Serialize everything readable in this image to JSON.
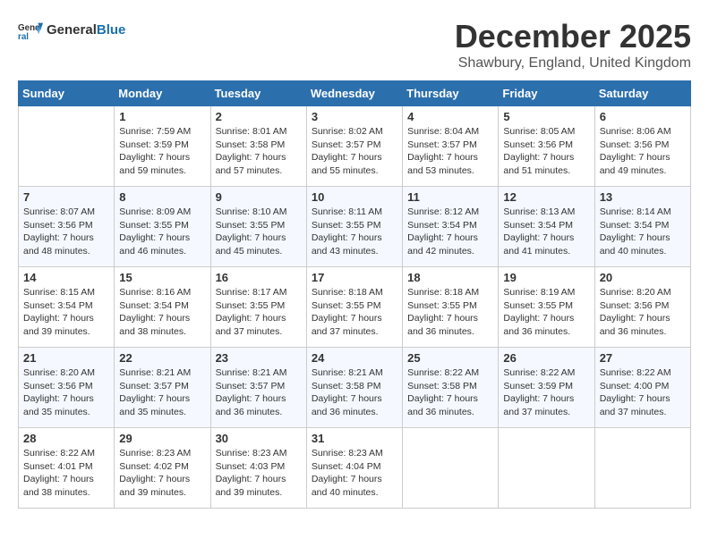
{
  "header": {
    "logo": {
      "general": "General",
      "blue": "Blue"
    },
    "title": "December 2025",
    "location": "Shawbury, England, United Kingdom"
  },
  "weekdays": [
    "Sunday",
    "Monday",
    "Tuesday",
    "Wednesday",
    "Thursday",
    "Friday",
    "Saturday"
  ],
  "weeks": [
    [
      {
        "day": "",
        "info": ""
      },
      {
        "day": "1",
        "info": "Sunrise: 7:59 AM\nSunset: 3:59 PM\nDaylight: 7 hours\nand 59 minutes."
      },
      {
        "day": "2",
        "info": "Sunrise: 8:01 AM\nSunset: 3:58 PM\nDaylight: 7 hours\nand 57 minutes."
      },
      {
        "day": "3",
        "info": "Sunrise: 8:02 AM\nSunset: 3:57 PM\nDaylight: 7 hours\nand 55 minutes."
      },
      {
        "day": "4",
        "info": "Sunrise: 8:04 AM\nSunset: 3:57 PM\nDaylight: 7 hours\nand 53 minutes."
      },
      {
        "day": "5",
        "info": "Sunrise: 8:05 AM\nSunset: 3:56 PM\nDaylight: 7 hours\nand 51 minutes."
      },
      {
        "day": "6",
        "info": "Sunrise: 8:06 AM\nSunset: 3:56 PM\nDaylight: 7 hours\nand 49 minutes."
      }
    ],
    [
      {
        "day": "7",
        "info": "Sunrise: 8:07 AM\nSunset: 3:56 PM\nDaylight: 7 hours\nand 48 minutes."
      },
      {
        "day": "8",
        "info": "Sunrise: 8:09 AM\nSunset: 3:55 PM\nDaylight: 7 hours\nand 46 minutes."
      },
      {
        "day": "9",
        "info": "Sunrise: 8:10 AM\nSunset: 3:55 PM\nDaylight: 7 hours\nand 45 minutes."
      },
      {
        "day": "10",
        "info": "Sunrise: 8:11 AM\nSunset: 3:55 PM\nDaylight: 7 hours\nand 43 minutes."
      },
      {
        "day": "11",
        "info": "Sunrise: 8:12 AM\nSunset: 3:54 PM\nDaylight: 7 hours\nand 42 minutes."
      },
      {
        "day": "12",
        "info": "Sunrise: 8:13 AM\nSunset: 3:54 PM\nDaylight: 7 hours\nand 41 minutes."
      },
      {
        "day": "13",
        "info": "Sunrise: 8:14 AM\nSunset: 3:54 PM\nDaylight: 7 hours\nand 40 minutes."
      }
    ],
    [
      {
        "day": "14",
        "info": "Sunrise: 8:15 AM\nSunset: 3:54 PM\nDaylight: 7 hours\nand 39 minutes."
      },
      {
        "day": "15",
        "info": "Sunrise: 8:16 AM\nSunset: 3:54 PM\nDaylight: 7 hours\nand 38 minutes."
      },
      {
        "day": "16",
        "info": "Sunrise: 8:17 AM\nSunset: 3:55 PM\nDaylight: 7 hours\nand 37 minutes."
      },
      {
        "day": "17",
        "info": "Sunrise: 8:18 AM\nSunset: 3:55 PM\nDaylight: 7 hours\nand 37 minutes."
      },
      {
        "day": "18",
        "info": "Sunrise: 8:18 AM\nSunset: 3:55 PM\nDaylight: 7 hours\nand 36 minutes."
      },
      {
        "day": "19",
        "info": "Sunrise: 8:19 AM\nSunset: 3:55 PM\nDaylight: 7 hours\nand 36 minutes."
      },
      {
        "day": "20",
        "info": "Sunrise: 8:20 AM\nSunset: 3:56 PM\nDaylight: 7 hours\nand 36 minutes."
      }
    ],
    [
      {
        "day": "21",
        "info": "Sunrise: 8:20 AM\nSunset: 3:56 PM\nDaylight: 7 hours\nand 35 minutes."
      },
      {
        "day": "22",
        "info": "Sunrise: 8:21 AM\nSunset: 3:57 PM\nDaylight: 7 hours\nand 35 minutes."
      },
      {
        "day": "23",
        "info": "Sunrise: 8:21 AM\nSunset: 3:57 PM\nDaylight: 7 hours\nand 36 minutes."
      },
      {
        "day": "24",
        "info": "Sunrise: 8:21 AM\nSunset: 3:58 PM\nDaylight: 7 hours\nand 36 minutes."
      },
      {
        "day": "25",
        "info": "Sunrise: 8:22 AM\nSunset: 3:58 PM\nDaylight: 7 hours\nand 36 minutes."
      },
      {
        "day": "26",
        "info": "Sunrise: 8:22 AM\nSunset: 3:59 PM\nDaylight: 7 hours\nand 37 minutes."
      },
      {
        "day": "27",
        "info": "Sunrise: 8:22 AM\nSunset: 4:00 PM\nDaylight: 7 hours\nand 37 minutes."
      }
    ],
    [
      {
        "day": "28",
        "info": "Sunrise: 8:22 AM\nSunset: 4:01 PM\nDaylight: 7 hours\nand 38 minutes."
      },
      {
        "day": "29",
        "info": "Sunrise: 8:23 AM\nSunset: 4:02 PM\nDaylight: 7 hours\nand 39 minutes."
      },
      {
        "day": "30",
        "info": "Sunrise: 8:23 AM\nSunset: 4:03 PM\nDaylight: 7 hours\nand 39 minutes."
      },
      {
        "day": "31",
        "info": "Sunrise: 8:23 AM\nSunset: 4:04 PM\nDaylight: 7 hours\nand 40 minutes."
      },
      {
        "day": "",
        "info": ""
      },
      {
        "day": "",
        "info": ""
      },
      {
        "day": "",
        "info": ""
      }
    ]
  ]
}
